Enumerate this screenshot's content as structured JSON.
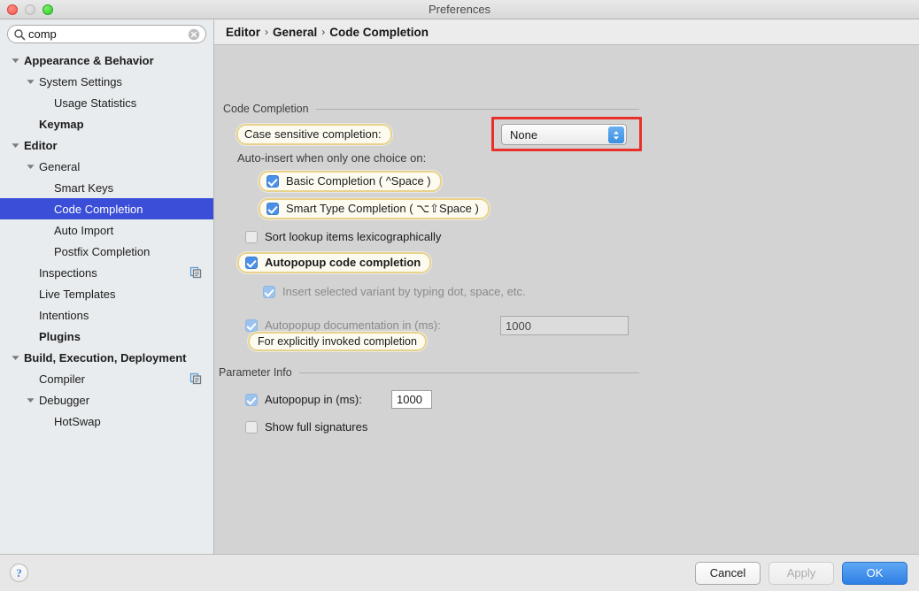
{
  "window": {
    "title": "Preferences",
    "traffic_lights": [
      "close",
      "minimize",
      "maximize"
    ]
  },
  "sidebar": {
    "search": {
      "value": "comp",
      "placeholder": "",
      "icon": "search-icon",
      "clear_icon": "clear-icon"
    },
    "items": [
      {
        "label": "Appearance & Behavior",
        "indent": 0,
        "twisty": "down",
        "bold": true,
        "selected": false,
        "badge": false
      },
      {
        "label": "System Settings",
        "indent": 1,
        "twisty": "down",
        "bold": false,
        "selected": false,
        "badge": false
      },
      {
        "label": "Usage Statistics",
        "indent": 2,
        "twisty": "none",
        "bold": false,
        "selected": false,
        "badge": false
      },
      {
        "label": "Keymap",
        "indent": 1,
        "twisty": "none",
        "bold": true,
        "selected": false,
        "badge": false
      },
      {
        "label": "Editor",
        "indent": 0,
        "twisty": "down",
        "bold": true,
        "selected": false,
        "badge": false
      },
      {
        "label": "General",
        "indent": 1,
        "twisty": "down",
        "bold": false,
        "selected": false,
        "badge": false
      },
      {
        "label": "Smart Keys",
        "indent": 2,
        "twisty": "none",
        "bold": false,
        "selected": false,
        "badge": false
      },
      {
        "label": "Code Completion",
        "indent": 2,
        "twisty": "none",
        "bold": false,
        "selected": true,
        "badge": false
      },
      {
        "label": "Auto Import",
        "indent": 2,
        "twisty": "none",
        "bold": false,
        "selected": false,
        "badge": false
      },
      {
        "label": "Postfix Completion",
        "indent": 2,
        "twisty": "none",
        "bold": false,
        "selected": false,
        "badge": false
      },
      {
        "label": "Inspections",
        "indent": 1,
        "twisty": "none",
        "bold": false,
        "selected": false,
        "badge": true
      },
      {
        "label": "Live Templates",
        "indent": 1,
        "twisty": "none",
        "bold": false,
        "selected": false,
        "badge": false
      },
      {
        "label": "Intentions",
        "indent": 1,
        "twisty": "none",
        "bold": false,
        "selected": false,
        "badge": false
      },
      {
        "label": "Plugins",
        "indent": 1,
        "twisty": "none",
        "bold": true,
        "selected": false,
        "badge": false
      },
      {
        "label": "Build, Execution, Deployment",
        "indent": 0,
        "twisty": "down",
        "bold": true,
        "selected": false,
        "badge": false
      },
      {
        "label": "Compiler",
        "indent": 1,
        "twisty": "none",
        "bold": false,
        "selected": false,
        "badge": true
      },
      {
        "label": "Debugger",
        "indent": 1,
        "twisty": "down",
        "bold": false,
        "selected": false,
        "badge": false
      },
      {
        "label": "HotSwap",
        "indent": 2,
        "twisty": "none",
        "bold": false,
        "selected": false,
        "badge": false
      }
    ]
  },
  "breadcrumb": {
    "parts": [
      "Editor",
      "General",
      "Code Completion"
    ],
    "separator": "›"
  },
  "main": {
    "group1_title": "Code Completion",
    "case_sensitive_label": "Case sensitive completion:",
    "case_sensitive_value": "None",
    "auto_insert_label": "Auto-insert when only one choice on:",
    "basic_completion_label": "Basic Completion ( ^Space )",
    "basic_completion_checked": true,
    "smart_type_label": "Smart Type Completion ( ⌥⇧Space )",
    "smart_type_checked": true,
    "sort_lookup_label": "Sort lookup items lexicographically",
    "sort_lookup_checked": false,
    "autopopup_code_label": "Autopopup code completion",
    "autopopup_code_checked": true,
    "insert_variant_label": "Insert selected variant by typing dot, space, etc.",
    "insert_variant_checked": true,
    "autopopup_doc_label": "Autopopup documentation in (ms):",
    "autopopup_doc_checked": true,
    "autopopup_doc_value": "1000",
    "autopopup_doc_sub_label": "For explicitly invoked completion",
    "group2_title": "Parameter Info",
    "param_autopopup_label": "Autopopup in (ms):",
    "param_autopopup_checked": true,
    "param_autopopup_value": "1000",
    "show_full_signatures_label": "Show full signatures",
    "show_full_signatures_checked": false
  },
  "footer": {
    "help_glyph": "?",
    "cancel_label": "Cancel",
    "apply_label": "Apply",
    "apply_enabled": false,
    "ok_label": "OK"
  },
  "colors": {
    "selection_blue": "#3b4ed8",
    "checkbox_blue": "#4a90e9",
    "highlight_border": "#e8d28a",
    "highlight_fill": "#fdfbf0",
    "red_outline": "#e8302a",
    "primary_button": "#2f7fe4"
  }
}
